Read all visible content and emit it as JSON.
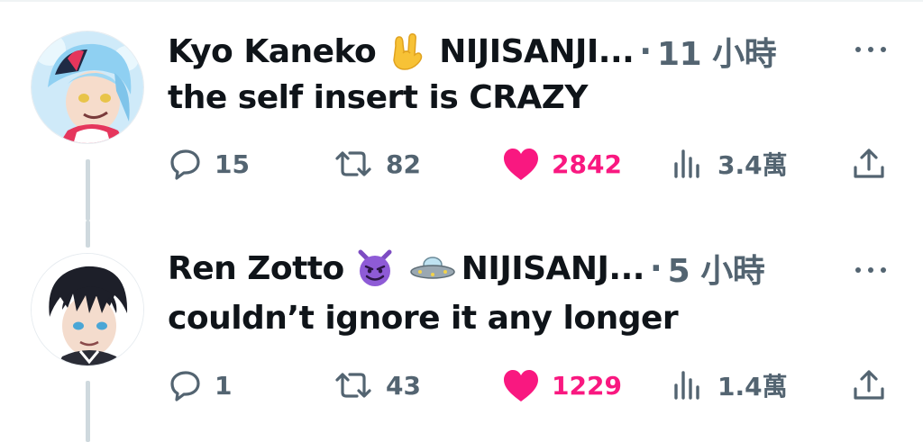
{
  "tweets": [
    {
      "display_name": "Kyo Kaneko",
      "name_emojis": [
        "sign-of-the-horns-emoji"
      ],
      "handle": "NIJISANJI...",
      "separator": "·",
      "time": "11 小時",
      "text": "the self insert is CRAZY",
      "replies": "15",
      "retweets": "82",
      "likes": "2842",
      "views": "3.4萬"
    },
    {
      "display_name": "Ren Zotto",
      "name_emojis": [
        "smiling-devil-emoji",
        "ufo-emoji"
      ],
      "handle": "NIJISANJ...",
      "separator": "·",
      "time": "5 小時",
      "text": "couldn’t ignore it any longer",
      "replies": "1",
      "retweets": "43",
      "likes": "1229",
      "views": "1.4萬"
    }
  ],
  "colors": {
    "text": "#0f1419",
    "secondary": "#536471",
    "like": "#f91880",
    "thread_line": "#cfd9de"
  },
  "icons": [
    "reply-icon",
    "retweet-icon",
    "heart-icon",
    "views-icon",
    "share-icon",
    "more-icon"
  ]
}
